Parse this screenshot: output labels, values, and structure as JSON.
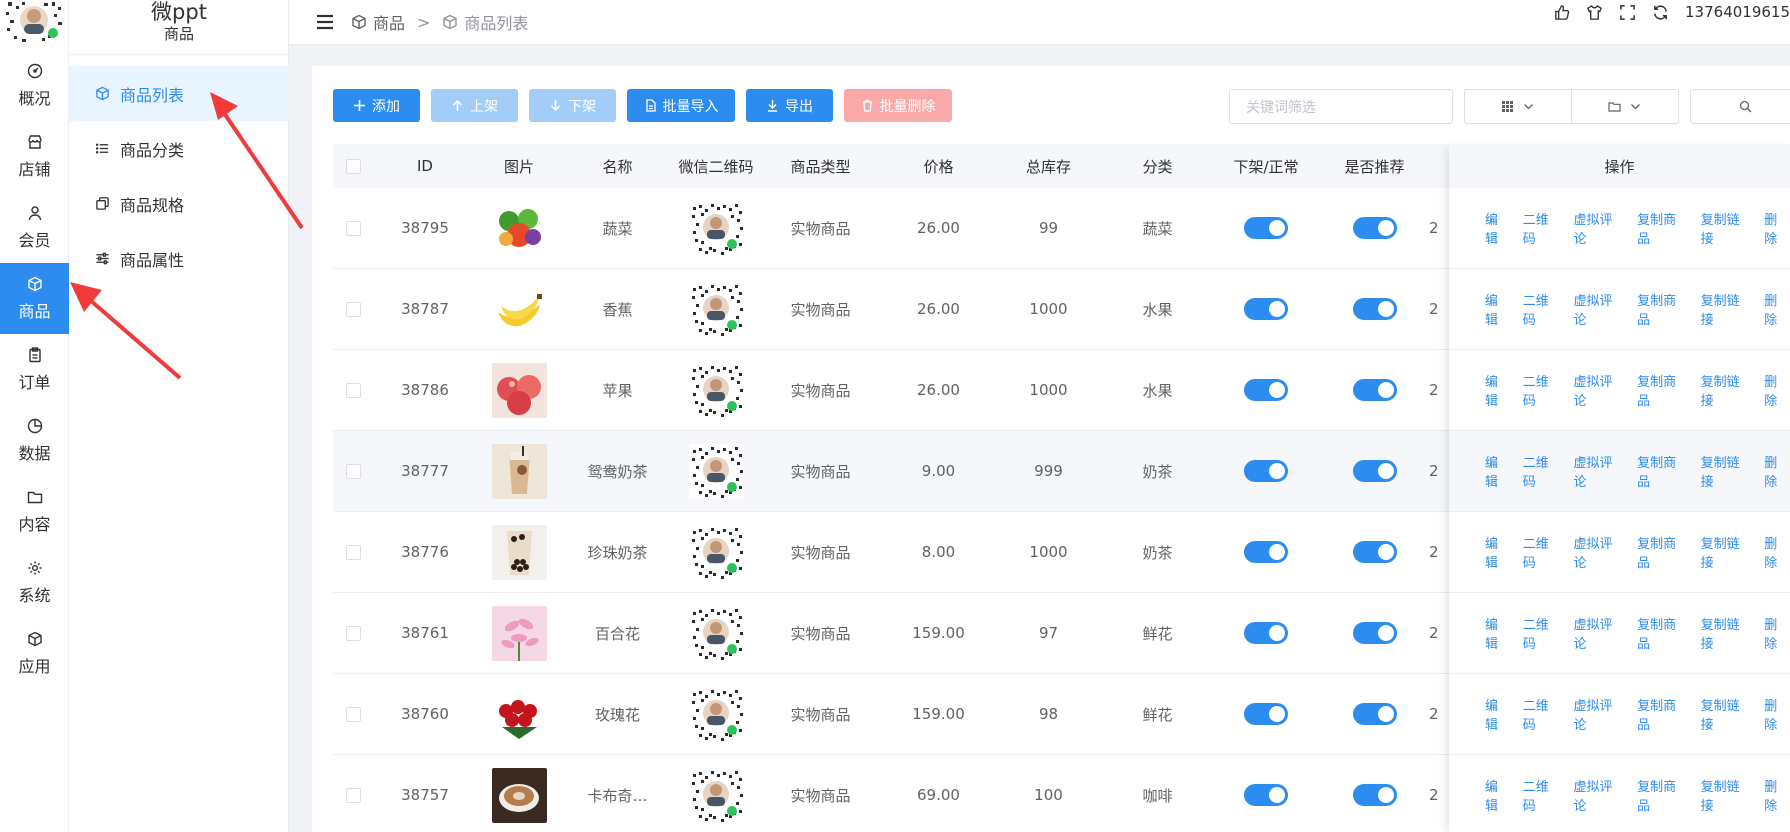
{
  "app": {
    "brand": "微ppt",
    "section": "商品"
  },
  "rail": [
    {
      "label": "概况",
      "icon": "dashboard-icon",
      "active": false
    },
    {
      "label": "店铺",
      "icon": "store-icon",
      "active": false
    },
    {
      "label": "会员",
      "icon": "user-icon",
      "active": false
    },
    {
      "label": "商品",
      "icon": "cube-icon",
      "active": true
    },
    {
      "label": "订单",
      "icon": "clipboard-icon",
      "active": false
    },
    {
      "label": "数据",
      "icon": "pie-chart-icon",
      "active": false
    },
    {
      "label": "内容",
      "icon": "folder-icon",
      "active": false
    },
    {
      "label": "系统",
      "icon": "gear-icon",
      "active": false
    },
    {
      "label": "应用",
      "icon": "cube-icon",
      "active": false
    }
  ],
  "submenu": [
    {
      "label": "商品列表",
      "icon": "cube-icon",
      "active": true
    },
    {
      "label": "商品分类",
      "icon": "list-icon",
      "active": false
    },
    {
      "label": "商品规格",
      "icon": "copy-icon",
      "active": false
    },
    {
      "label": "商品属性",
      "icon": "sliders-icon",
      "active": false
    }
  ],
  "breadcrumb": {
    "first": "商品",
    "sep": ">",
    "second": "商品列表"
  },
  "topright": {
    "phone": "13764019615"
  },
  "toolbar": {
    "add": "添加",
    "on_shelf": "上架",
    "off_shelf": "下架",
    "import": "批量导入",
    "export": "导出",
    "batch_delete": "批量删除"
  },
  "search": {
    "placeholder": "关键词筛选"
  },
  "columns": {
    "id": "ID",
    "image": "图片",
    "name": "名称",
    "qr": "微信二维码",
    "type": "商品类型",
    "price": "价格",
    "stock": "总库存",
    "category": "分类",
    "status": "下架/正常",
    "recommend": "是否推荐",
    "ops": "操作"
  },
  "ops": [
    "编辑",
    "二维码",
    "虚拟评论",
    "复制商品",
    "复制链接",
    "删除"
  ],
  "rows": [
    {
      "id": "38795",
      "name": "蔬菜",
      "type": "实物商品",
      "price": "26.00",
      "stock": "99",
      "category": "蔬菜",
      "trunc": "2",
      "img": "veg",
      "status_on": true,
      "recommend_on": true
    },
    {
      "id": "38787",
      "name": "香蕉",
      "type": "实物商品",
      "price": "26.00",
      "stock": "1000",
      "category": "水果",
      "trunc": "2",
      "img": "banana",
      "status_on": true,
      "recommend_on": true
    },
    {
      "id": "38786",
      "name": "苹果",
      "type": "实物商品",
      "price": "26.00",
      "stock": "1000",
      "category": "水果",
      "trunc": "2",
      "img": "apple",
      "status_on": true,
      "recommend_on": true
    },
    {
      "id": "38777",
      "name": "鸳鸯奶茶",
      "type": "实物商品",
      "price": "9.00",
      "stock": "999",
      "category": "奶茶",
      "trunc": "2",
      "img": "milktea",
      "status_on": true,
      "recommend_on": true
    },
    {
      "id": "38776",
      "name": "珍珠奶茶",
      "type": "实物商品",
      "price": "8.00",
      "stock": "1000",
      "category": "奶茶",
      "trunc": "2",
      "img": "pearl",
      "status_on": true,
      "recommend_on": true
    },
    {
      "id": "38761",
      "name": "百合花",
      "type": "实物商品",
      "price": "159.00",
      "stock": "97",
      "category": "鲜花",
      "trunc": "2",
      "img": "lily",
      "status_on": true,
      "recommend_on": true
    },
    {
      "id": "38760",
      "name": "玫瑰花",
      "type": "实物商品",
      "price": "159.00",
      "stock": "98",
      "category": "鲜花",
      "trunc": "2",
      "img": "rose",
      "status_on": true,
      "recommend_on": true
    },
    {
      "id": "38757",
      "name": "卡布奇…",
      "type": "实物商品",
      "price": "69.00",
      "stock": "100",
      "category": "咖啡",
      "trunc": "2",
      "img": "coffee",
      "status_on": true,
      "recommend_on": true
    }
  ],
  "colors": {
    "primary": "#2d8cf0",
    "primary_disabled": "#a3cdf6",
    "danger_disabled": "#f9a9a9"
  }
}
